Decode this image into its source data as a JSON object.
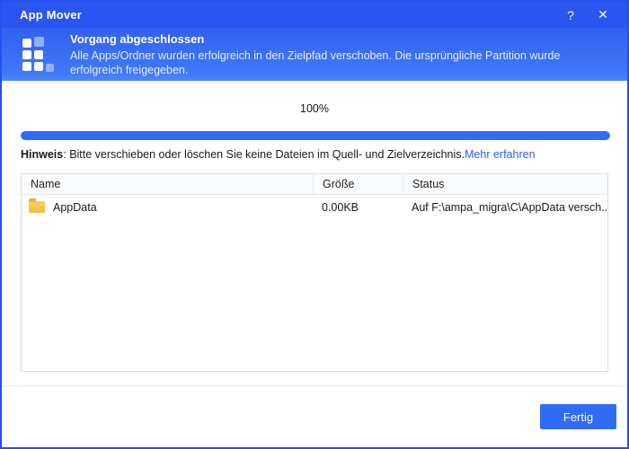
{
  "window": {
    "title": "App Mover",
    "help_glyph": "?",
    "close_glyph": "✕"
  },
  "header": {
    "title": "Vorgang abgeschlossen",
    "message": "Alle Apps/Ordner wurden erfolgreich in den Zielpfad verschoben. Die ursprüngliche Partition wurde erfolgreich freigegeben."
  },
  "progress": {
    "percent": 100,
    "percent_label": "100%"
  },
  "notice": {
    "prefix": "Hinweis",
    "text": ": Bitte verschieben oder löschen Sie keine Dateien im Quell- und Zielverzeichnis.",
    "link_label": "Mehr erfahren"
  },
  "table": {
    "columns": {
      "name": "Name",
      "size": "Größe",
      "status": "Status"
    },
    "rows": [
      {
        "icon": "folder-icon",
        "name": "AppData",
        "size": "0.00KB",
        "status": "Auf F:\\ampa_migra\\C\\AppData versch..."
      }
    ]
  },
  "footer": {
    "done_label": "Fertig"
  },
  "colors": {
    "titlebar": "#2b55f0",
    "header_gradient_top": "#3160f1",
    "header_gradient_bottom": "#4c88fa",
    "progress_fill": "#2f6bfa",
    "link": "#2e5bff",
    "button": "#2f6bf5",
    "folder": "#f2bc42",
    "window_border": "#2350ee"
  }
}
